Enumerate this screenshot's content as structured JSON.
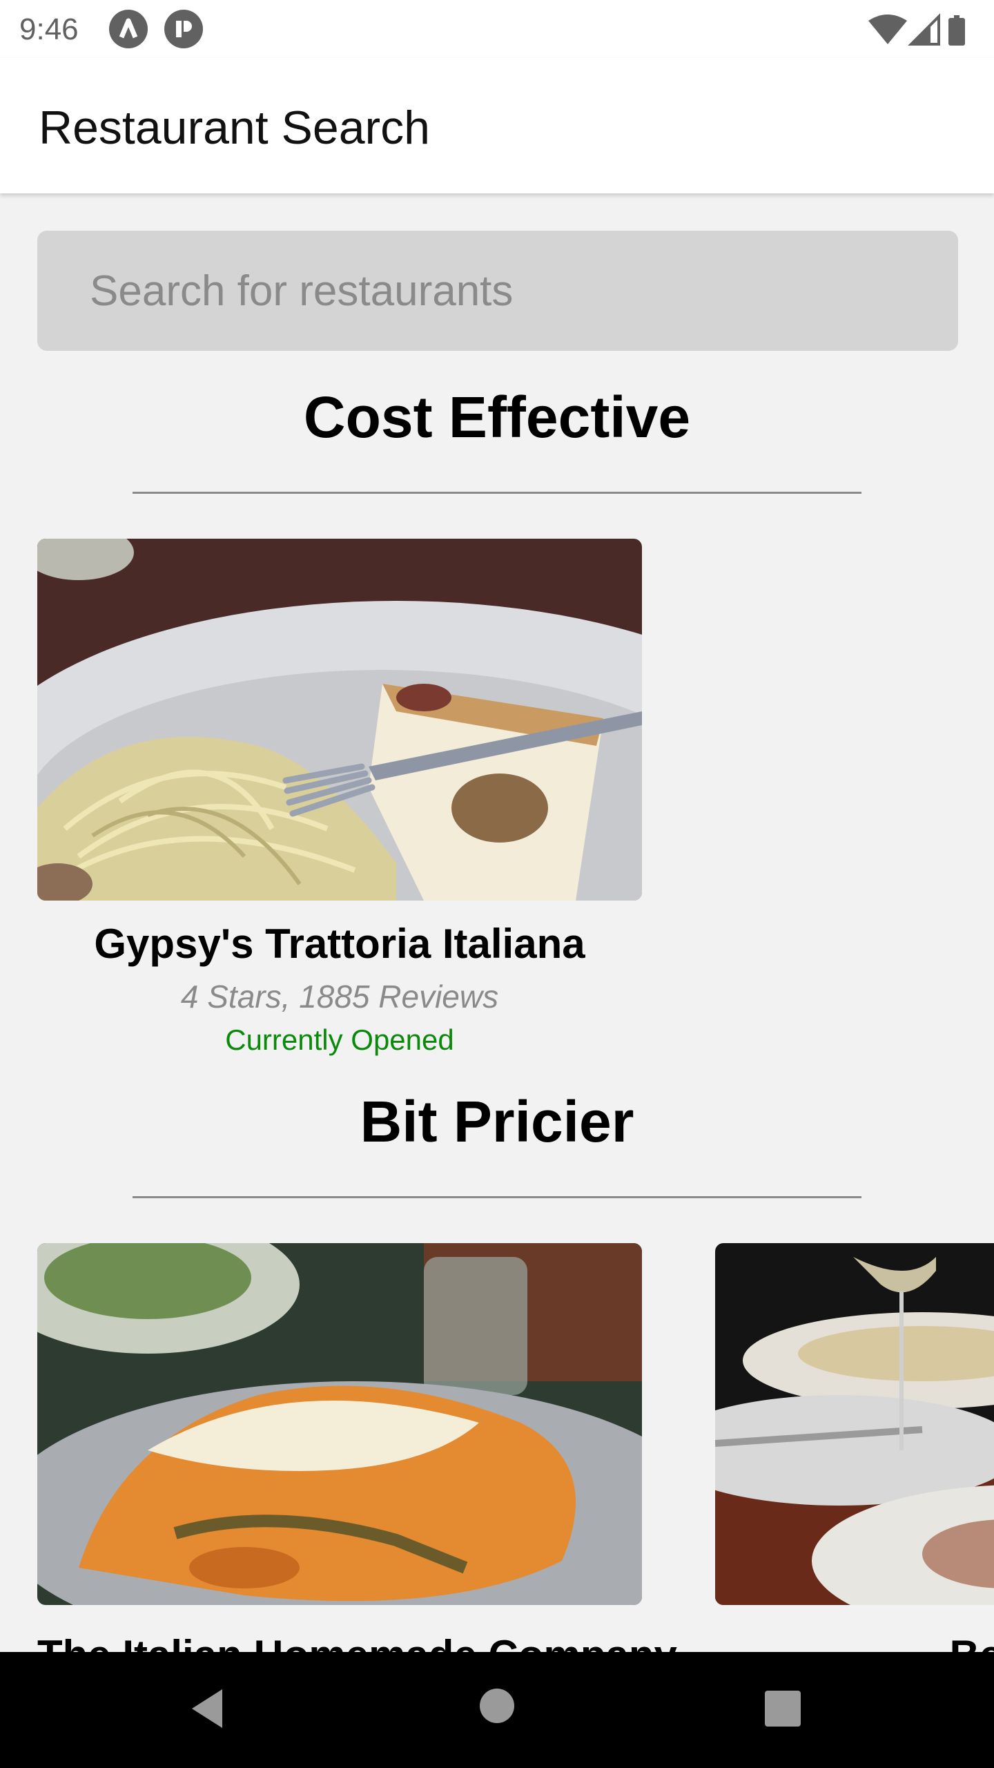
{
  "status_bar": {
    "time": "9:46"
  },
  "app_bar": {
    "title": "Restaurant Search"
  },
  "search": {
    "placeholder": "Search for restaurants"
  },
  "sections": [
    {
      "title": "Cost Effective",
      "restaurants": [
        {
          "name": "Gypsy's Trattoria Italiana",
          "rating": "4 Stars, 1885 Reviews",
          "status": "Currently Opened"
        }
      ]
    },
    {
      "title": "Bit Pricier",
      "restaurants": [
        {
          "name": "The Italian Homemade Company"
        },
        {
          "name": "Bella T"
        }
      ]
    }
  ],
  "colors": {
    "open_status": "#0a8a0a",
    "search_bg": "#d4d4d4",
    "background": "#f2f2f2"
  },
  "icons": [
    "app-a-icon",
    "app-p-icon",
    "wifi-icon",
    "cell-signal-icon",
    "battery-icon",
    "back-icon",
    "home-icon",
    "recents-icon"
  ]
}
